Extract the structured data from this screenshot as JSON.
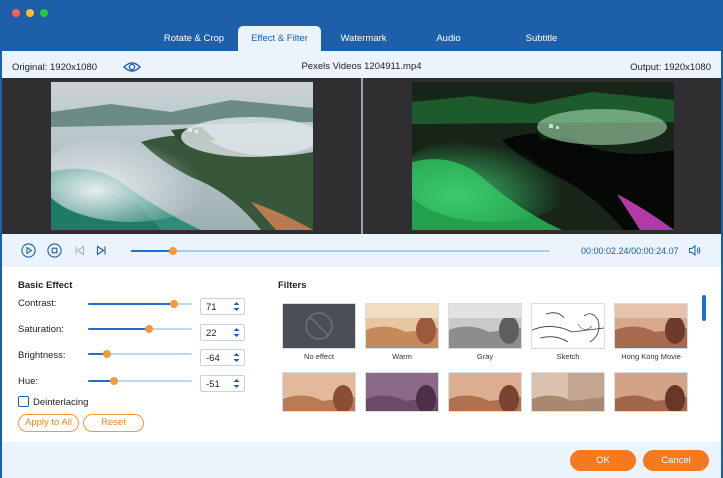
{
  "window": {
    "traffic_lights": [
      {
        "name": "close",
        "color": "#ff5f57"
      },
      {
        "name": "minimize",
        "color": "#febc2e"
      },
      {
        "name": "zoom",
        "color": "#28c840"
      }
    ]
  },
  "tabs": [
    {
      "label": "Rotate & Crop",
      "active": false
    },
    {
      "label": "Effect & Filter",
      "active": true
    },
    {
      "label": "Watermark",
      "active": false
    },
    {
      "label": "Audio",
      "active": false
    },
    {
      "label": "Subtitle",
      "active": false
    }
  ],
  "infobar": {
    "original_label": "Original: 1920x1080",
    "file_name": "Pexels Videos 1204911.mp4",
    "output_label": "Output: 1920x1080",
    "eye_icon": "eye-icon"
  },
  "playback": {
    "current_time": "00:00:02.24",
    "separator": "/",
    "total_time": "00:00:24.07",
    "progress": 0.1,
    "icons": [
      "play-icon",
      "stop-icon",
      "previous-frame-icon",
      "next-frame-icon",
      "volume-icon"
    ]
  },
  "basic_effect": {
    "title": "Basic Effect",
    "sliders": [
      {
        "label": "Contrast:",
        "value": "71",
        "level": 0.83
      },
      {
        "label": "Saturation:",
        "value": "22",
        "level": 0.59
      },
      {
        "label": "Brightness:",
        "value": "-64",
        "level": 0.18
      },
      {
        "label": "Hue:",
        "value": "-51",
        "level": 0.25
      }
    ],
    "deinterlacing_label": "Deinterlacing",
    "deinterlacing_checked": false,
    "apply_all_label": "Apply to All",
    "reset_label": "Reset"
  },
  "filters": {
    "title": "Filters",
    "items": [
      {
        "name": "No effect"
      },
      {
        "name": "Warm"
      },
      {
        "name": "Gray"
      },
      {
        "name": "Sketch"
      },
      {
        "name": "Hong Kong Movie"
      },
      {
        "name": ""
      },
      {
        "name": ""
      },
      {
        "name": ""
      },
      {
        "name": ""
      },
      {
        "name": ""
      }
    ]
  },
  "footer": {
    "ok_label": "OK",
    "cancel_label": "Cancel"
  },
  "colors": {
    "brand_blue": "#1d5fa8",
    "accent_orange": "#f5791f",
    "panel_bg": "#ebf3fc"
  }
}
